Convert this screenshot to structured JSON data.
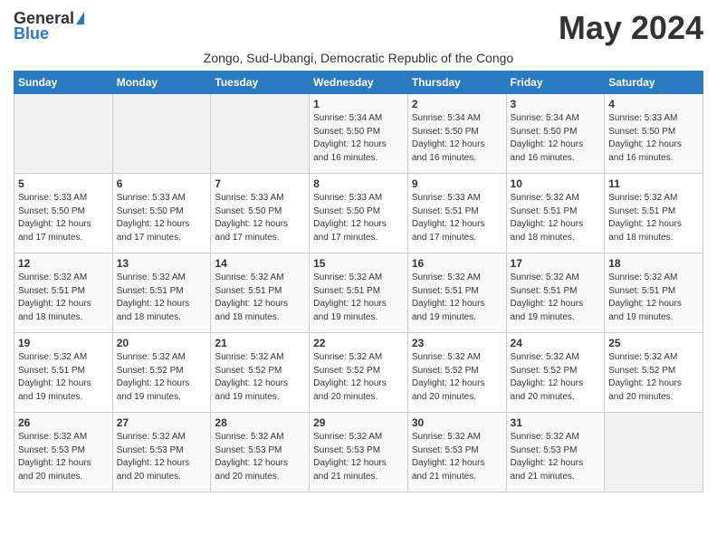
{
  "logo": {
    "line1": "General",
    "line2": "Blue"
  },
  "title": "May 2024",
  "subtitle": "Zongo, Sud-Ubangi, Democratic Republic of the Congo",
  "days_of_week": [
    "Sunday",
    "Monday",
    "Tuesday",
    "Wednesday",
    "Thursday",
    "Friday",
    "Saturday"
  ],
  "weeks": [
    [
      {
        "day": "",
        "info": ""
      },
      {
        "day": "",
        "info": ""
      },
      {
        "day": "",
        "info": ""
      },
      {
        "day": "1",
        "info": "Sunrise: 5:34 AM\nSunset: 5:50 PM\nDaylight: 12 hours\nand 16 minutes."
      },
      {
        "day": "2",
        "info": "Sunrise: 5:34 AM\nSunset: 5:50 PM\nDaylight: 12 hours\nand 16 minutes."
      },
      {
        "day": "3",
        "info": "Sunrise: 5:34 AM\nSunset: 5:50 PM\nDaylight: 12 hours\nand 16 minutes."
      },
      {
        "day": "4",
        "info": "Sunrise: 5:33 AM\nSunset: 5:50 PM\nDaylight: 12 hours\nand 16 minutes."
      }
    ],
    [
      {
        "day": "5",
        "info": "Sunrise: 5:33 AM\nSunset: 5:50 PM\nDaylight: 12 hours\nand 17 minutes."
      },
      {
        "day": "6",
        "info": "Sunrise: 5:33 AM\nSunset: 5:50 PM\nDaylight: 12 hours\nand 17 minutes."
      },
      {
        "day": "7",
        "info": "Sunrise: 5:33 AM\nSunset: 5:50 PM\nDaylight: 12 hours\nand 17 minutes."
      },
      {
        "day": "8",
        "info": "Sunrise: 5:33 AM\nSunset: 5:50 PM\nDaylight: 12 hours\nand 17 minutes."
      },
      {
        "day": "9",
        "info": "Sunrise: 5:33 AM\nSunset: 5:51 PM\nDaylight: 12 hours\nand 17 minutes."
      },
      {
        "day": "10",
        "info": "Sunrise: 5:32 AM\nSunset: 5:51 PM\nDaylight: 12 hours\nand 18 minutes."
      },
      {
        "day": "11",
        "info": "Sunrise: 5:32 AM\nSunset: 5:51 PM\nDaylight: 12 hours\nand 18 minutes."
      }
    ],
    [
      {
        "day": "12",
        "info": "Sunrise: 5:32 AM\nSunset: 5:51 PM\nDaylight: 12 hours\nand 18 minutes."
      },
      {
        "day": "13",
        "info": "Sunrise: 5:32 AM\nSunset: 5:51 PM\nDaylight: 12 hours\nand 18 minutes."
      },
      {
        "day": "14",
        "info": "Sunrise: 5:32 AM\nSunset: 5:51 PM\nDaylight: 12 hours\nand 18 minutes."
      },
      {
        "day": "15",
        "info": "Sunrise: 5:32 AM\nSunset: 5:51 PM\nDaylight: 12 hours\nand 19 minutes."
      },
      {
        "day": "16",
        "info": "Sunrise: 5:32 AM\nSunset: 5:51 PM\nDaylight: 12 hours\nand 19 minutes."
      },
      {
        "day": "17",
        "info": "Sunrise: 5:32 AM\nSunset: 5:51 PM\nDaylight: 12 hours\nand 19 minutes."
      },
      {
        "day": "18",
        "info": "Sunrise: 5:32 AM\nSunset: 5:51 PM\nDaylight: 12 hours\nand 19 minutes."
      }
    ],
    [
      {
        "day": "19",
        "info": "Sunrise: 5:32 AM\nSunset: 5:51 PM\nDaylight: 12 hours\nand 19 minutes."
      },
      {
        "day": "20",
        "info": "Sunrise: 5:32 AM\nSunset: 5:52 PM\nDaylight: 12 hours\nand 19 minutes."
      },
      {
        "day": "21",
        "info": "Sunrise: 5:32 AM\nSunset: 5:52 PM\nDaylight: 12 hours\nand 19 minutes."
      },
      {
        "day": "22",
        "info": "Sunrise: 5:32 AM\nSunset: 5:52 PM\nDaylight: 12 hours\nand 20 minutes."
      },
      {
        "day": "23",
        "info": "Sunrise: 5:32 AM\nSunset: 5:52 PM\nDaylight: 12 hours\nand 20 minutes."
      },
      {
        "day": "24",
        "info": "Sunrise: 5:32 AM\nSunset: 5:52 PM\nDaylight: 12 hours\nand 20 minutes."
      },
      {
        "day": "25",
        "info": "Sunrise: 5:32 AM\nSunset: 5:52 PM\nDaylight: 12 hours\nand 20 minutes."
      }
    ],
    [
      {
        "day": "26",
        "info": "Sunrise: 5:32 AM\nSunset: 5:53 PM\nDaylight: 12 hours\nand 20 minutes."
      },
      {
        "day": "27",
        "info": "Sunrise: 5:32 AM\nSunset: 5:53 PM\nDaylight: 12 hours\nand 20 minutes."
      },
      {
        "day": "28",
        "info": "Sunrise: 5:32 AM\nSunset: 5:53 PM\nDaylight: 12 hours\nand 20 minutes."
      },
      {
        "day": "29",
        "info": "Sunrise: 5:32 AM\nSunset: 5:53 PM\nDaylight: 12 hours\nand 21 minutes."
      },
      {
        "day": "30",
        "info": "Sunrise: 5:32 AM\nSunset: 5:53 PM\nDaylight: 12 hours\nand 21 minutes."
      },
      {
        "day": "31",
        "info": "Sunrise: 5:32 AM\nSunset: 5:53 PM\nDaylight: 12 hours\nand 21 minutes."
      },
      {
        "day": "",
        "info": ""
      }
    ]
  ]
}
